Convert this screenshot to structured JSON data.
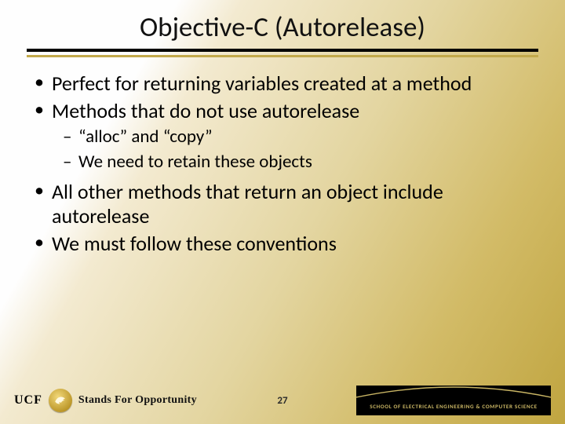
{
  "title": "Objective-C (Autorelease)",
  "bullets": {
    "b1": "Perfect for returning variables created at a method",
    "b2": "Methods that do not use autorelease",
    "b2_sub1": "“alloc” and “copy”",
    "b2_sub2": "We need to retain these objects",
    "b3": "All other methods that return an object include autorelease",
    "b4": "We must follow these conventions"
  },
  "footer": {
    "page": "27",
    "ucf": "UCF",
    "tagline": "Stands For Opportunity",
    "school": "SCHOOL OF ELECTRICAL ENGINEERING & COMPUTER SCIENCE"
  }
}
